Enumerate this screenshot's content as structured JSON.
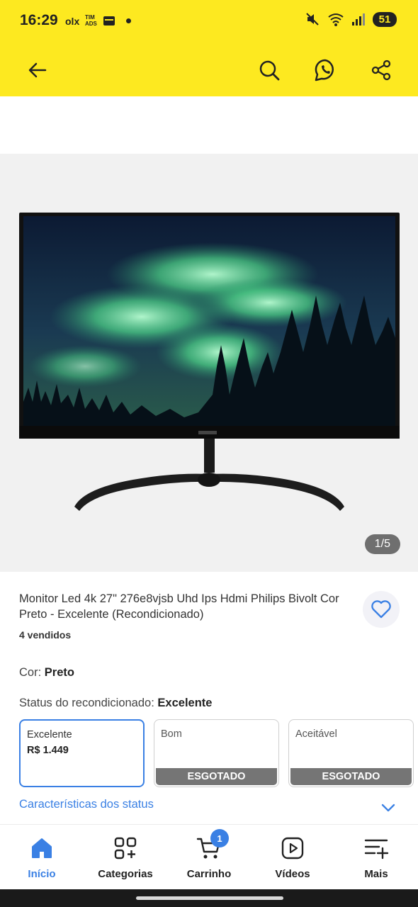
{
  "status_bar": {
    "time": "16:29",
    "olx_label": "olx",
    "carrier_label": "TIM ADS",
    "battery": "51"
  },
  "app_bar": {
    "back_icon": "arrow-left-icon",
    "search_icon": "search-icon",
    "whatsapp_icon": "whatsapp-icon",
    "share_icon": "share-icon"
  },
  "gallery": {
    "counter": "1/5",
    "image_alt_icon": "monitor-product-image"
  },
  "product": {
    "title": "Monitor Led 4k 27\" 276e8vjsb Uhd Ips Hdmi Philips Bivolt Cor Preto - Excelente (Recondicionado)",
    "sold": "4 vendidos",
    "color_label": "Cor:",
    "color_value": "Preto",
    "status_label": "Status do recondicionado:",
    "status_value": "Excelente"
  },
  "options": [
    {
      "name": "Excelente",
      "price": "R$ 1.449",
      "selected": true
    },
    {
      "name": "Bom",
      "badge": "ESGOTADO",
      "selected": false
    },
    {
      "name": "Aceitável",
      "badge": "ESGOTADO",
      "selected": false
    }
  ],
  "status_link": "Características dos status",
  "bottom_nav": {
    "items": [
      {
        "label": "Início",
        "icon": "home-icon",
        "active": true
      },
      {
        "label": "Categorias",
        "icon": "categories-icon"
      },
      {
        "label": "Carrinho",
        "icon": "cart-icon",
        "badge": "1"
      },
      {
        "label": "Vídeos",
        "icon": "video-icon"
      },
      {
        "label": "Mais",
        "icon": "menu-plus-icon"
      }
    ]
  },
  "colors": {
    "brand_yellow": "#fde920",
    "accent_blue": "#3a80e4",
    "sold_out_gray": "#757575"
  }
}
